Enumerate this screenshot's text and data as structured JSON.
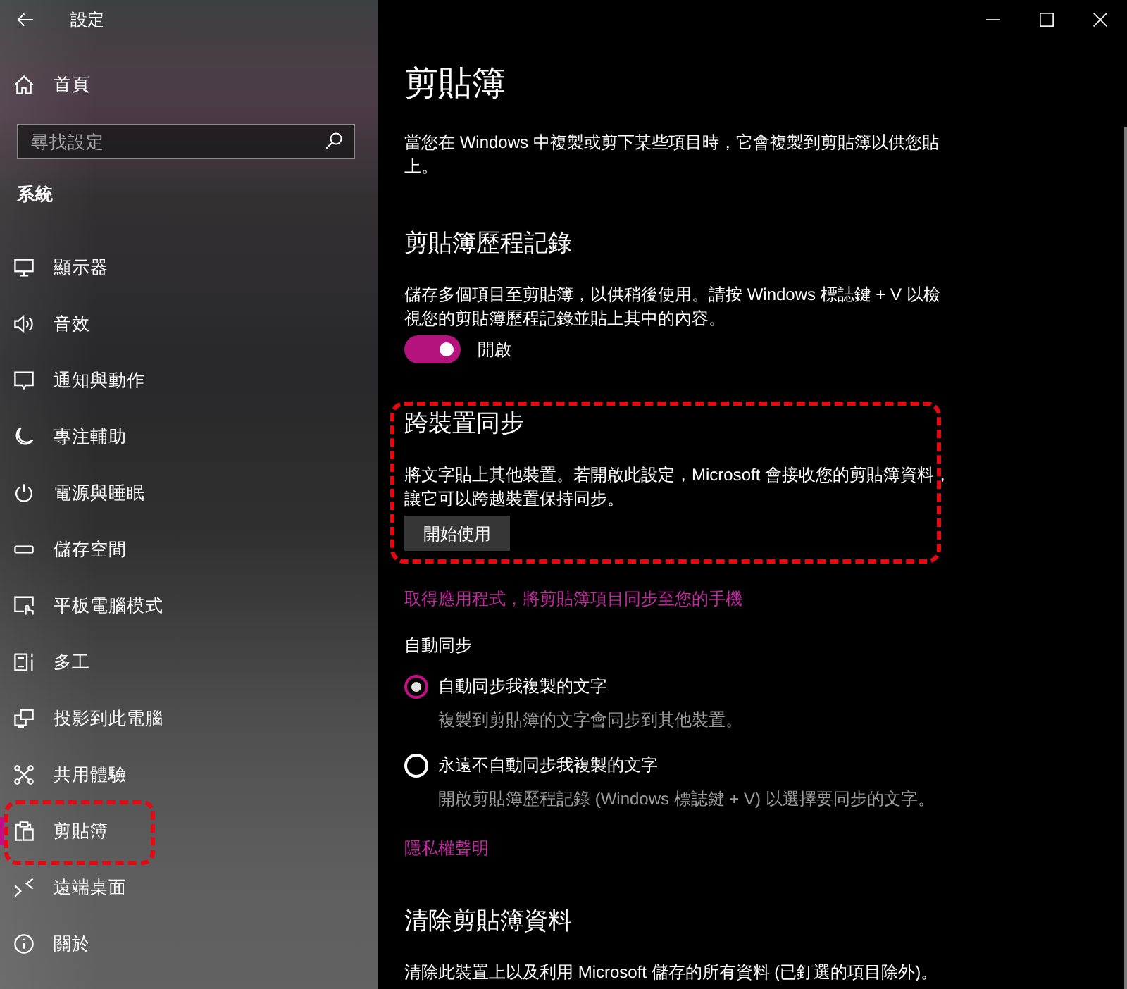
{
  "window": {
    "title": "設定"
  },
  "sidebar": {
    "home": "首頁",
    "search": {
      "placeholder": "尋找設定"
    },
    "group": "系統",
    "items": [
      {
        "label": "顯示器",
        "selected": false,
        "highlighted": false
      },
      {
        "label": "音效",
        "selected": false,
        "highlighted": false
      },
      {
        "label": "通知與動作",
        "selected": false,
        "highlighted": false
      },
      {
        "label": "專注輔助",
        "selected": false,
        "highlighted": false
      },
      {
        "label": "電源與睡眠",
        "selected": false,
        "highlighted": false
      },
      {
        "label": "儲存空間",
        "selected": false,
        "highlighted": false
      },
      {
        "label": "平板電腦模式",
        "selected": false,
        "highlighted": false
      },
      {
        "label": "多工",
        "selected": false,
        "highlighted": false
      },
      {
        "label": "投影到此電腦",
        "selected": false,
        "highlighted": false
      },
      {
        "label": "共用體驗",
        "selected": false,
        "highlighted": false
      },
      {
        "label": "剪貼簿",
        "selected": true,
        "highlighted": true
      },
      {
        "label": "遠端桌面",
        "selected": false,
        "highlighted": false
      },
      {
        "label": "關於",
        "selected": false,
        "highlighted": false
      }
    ]
  },
  "page": {
    "title": "剪貼簿",
    "description": "當您在 Windows 中複製或剪下某些項目時，它會複製到剪貼簿以供您貼上。"
  },
  "content": [
    {
      "kind": "section",
      "heading": "剪貼簿歷程記錄",
      "text": "儲存多個項目至剪貼簿，以供稍後使用。請按 Windows 標誌鍵 + V 以檢視您的剪貼簿歷程記錄並貼上其中的內容。",
      "toggle": {
        "on": true,
        "label": "開啟"
      },
      "highlighted": false
    },
    {
      "kind": "section",
      "heading": "跨裝置同步",
      "text": "將文字貼上其他裝置。若開啟此設定，Microsoft 會接收您的剪貼簿資料，讓它可以跨越裝置保持同步。",
      "button": "開始使用",
      "highlighted": true
    },
    {
      "kind": "link",
      "text": "取得應用程式，將剪貼簿項目同步至您的手機",
      "highlighted": false
    },
    {
      "kind": "radio_group",
      "label": "自動同步",
      "options": [
        {
          "label": "自動同步我複製的文字",
          "hint": "複製到剪貼簿的文字會同步到其他裝置。",
          "selected": true
        },
        {
          "label": "永遠不自動同步我複製的文字",
          "hint": "開啟剪貼簿歷程記錄 (Windows 標誌鍵 + V) 以選擇要同步的文字。",
          "selected": false
        }
      ],
      "highlighted": false
    },
    {
      "kind": "link",
      "text": "隱私權聲明",
      "highlighted": false
    },
    {
      "kind": "section",
      "heading": "清除剪貼簿資料",
      "text": "清除此裝置上以及利用 Microsoft 儲存的所有資料 (已釘選的項目除外)。",
      "highlighted": false
    }
  ]
}
